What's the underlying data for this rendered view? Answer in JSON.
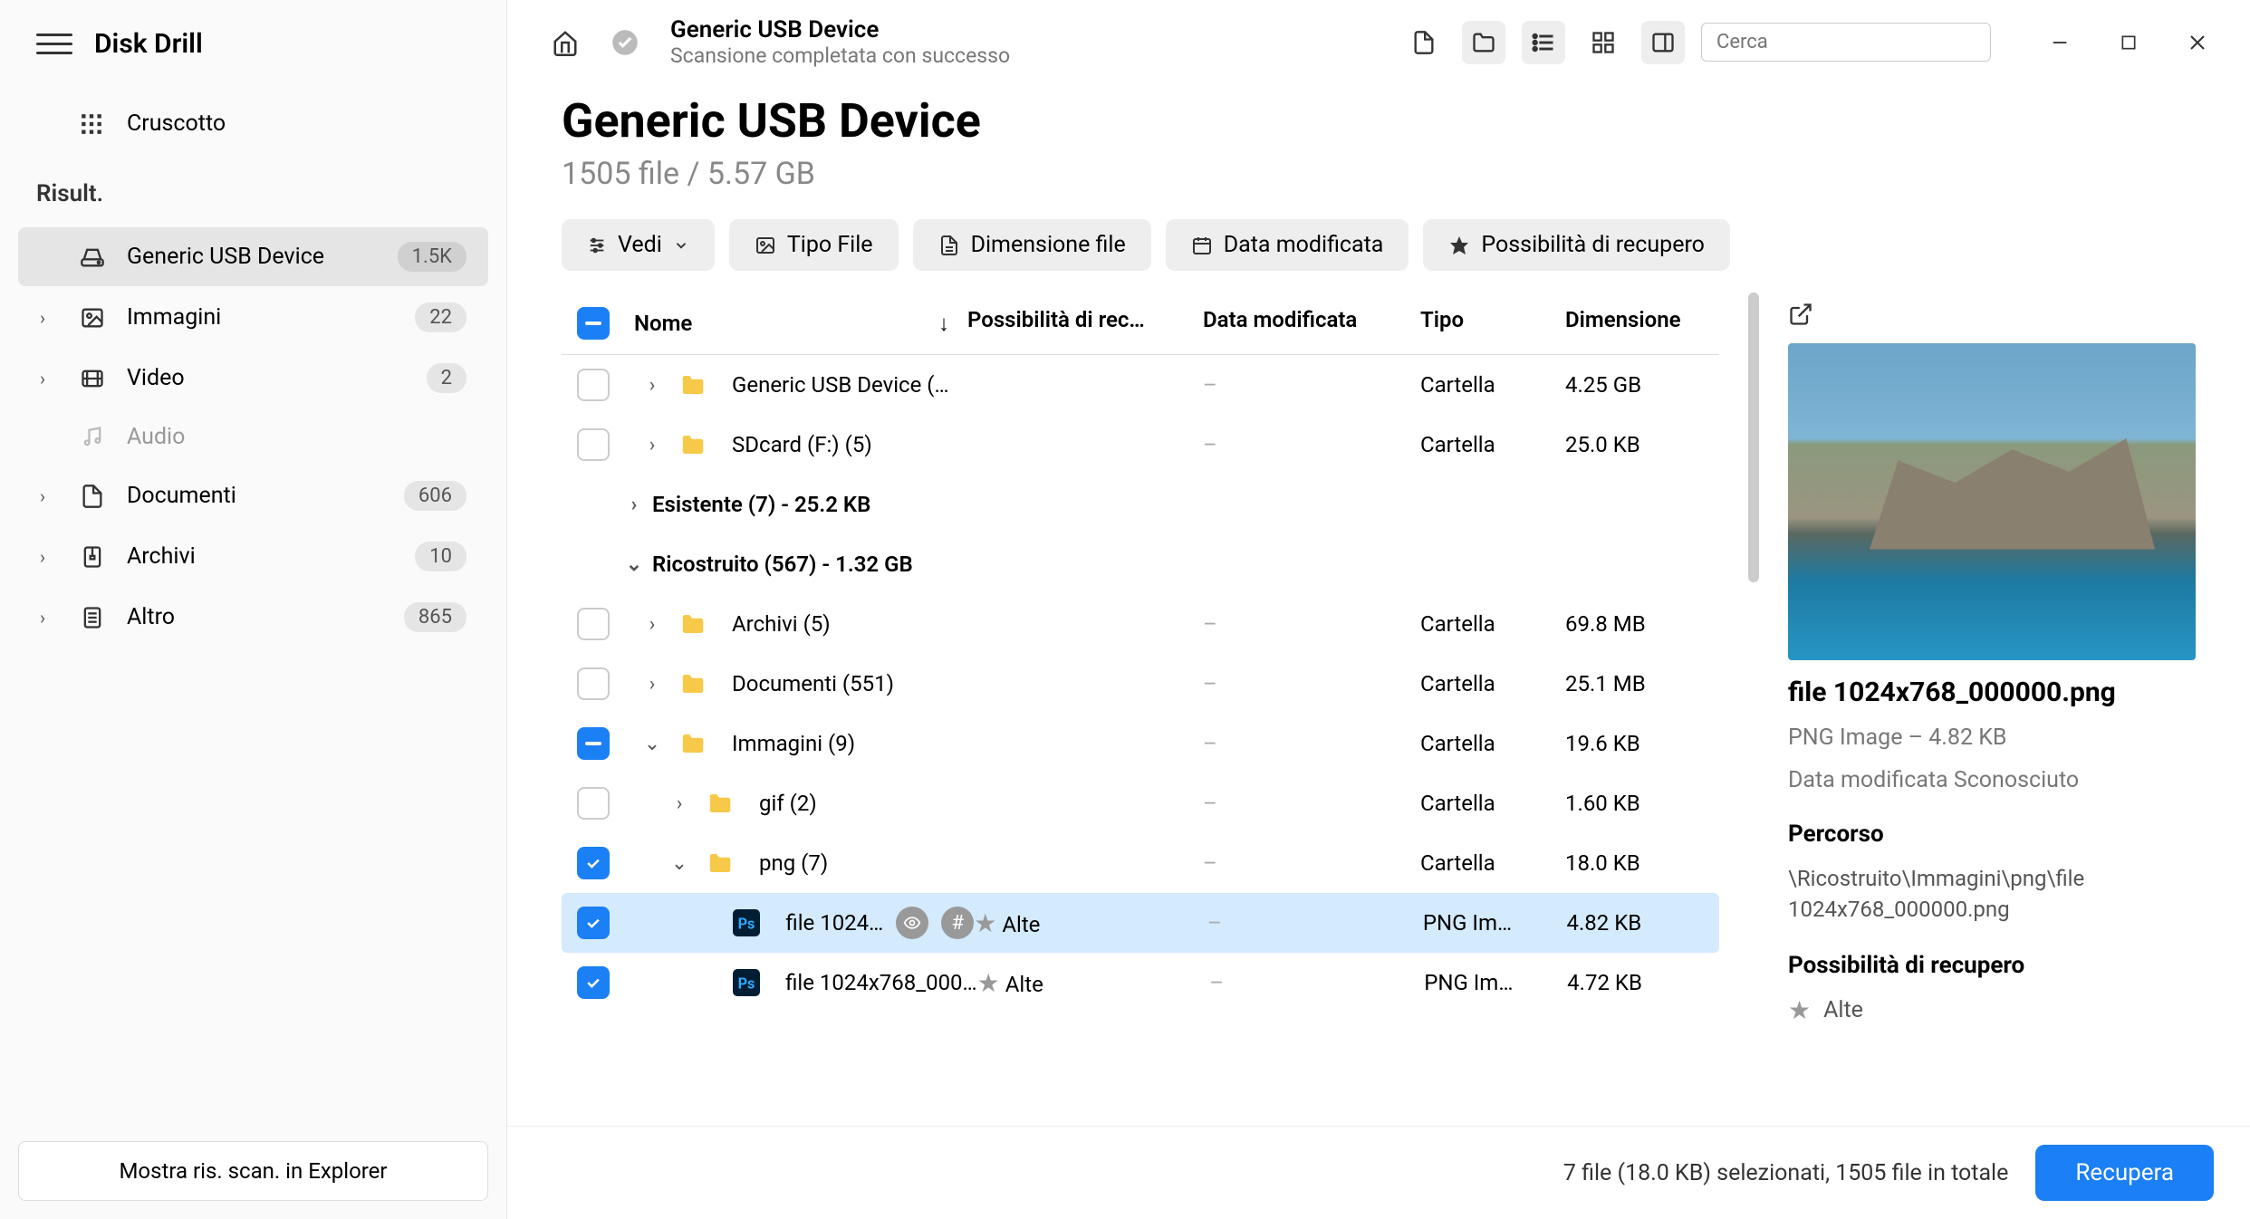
{
  "app": {
    "title": "Disk Drill"
  },
  "sidebar": {
    "dashboard": "Cruscotto",
    "results_label": "Risult.",
    "items": [
      {
        "label": "Generic USB Device",
        "badge": "1.5K",
        "icon": "drive",
        "active": true,
        "chevron": false
      },
      {
        "label": "Immagini",
        "badge": "22",
        "icon": "image",
        "chevron": true
      },
      {
        "label": "Video",
        "badge": "2",
        "icon": "video",
        "chevron": true
      },
      {
        "label": "Audio",
        "badge": "",
        "icon": "audio",
        "chevron": false,
        "dim": true
      },
      {
        "label": "Documenti",
        "badge": "606",
        "icon": "document",
        "chevron": true
      },
      {
        "label": "Archivi",
        "badge": "10",
        "icon": "archive",
        "chevron": true
      },
      {
        "label": "Altro",
        "badge": "865",
        "icon": "other",
        "chevron": true
      }
    ],
    "footer_btn": "Mostra ris. scan. in Explorer"
  },
  "toolbar": {
    "title": "Generic USB Device",
    "subtitle": "Scansione completata con successo",
    "search_placeholder": "Cerca"
  },
  "header": {
    "title": "Generic USB Device",
    "subtitle": "1505 file / 5.57 GB"
  },
  "filters": {
    "view": "Vedi",
    "type": "Tipo File",
    "size": "Dimensione file",
    "date": "Data modificata",
    "recov": "Possibilità di recupero"
  },
  "columns": {
    "name": "Nome",
    "recov": "Possibilità di rec…",
    "date": "Data modificata",
    "type": "Tipo",
    "size": "Dimensione"
  },
  "rows": [
    {
      "kind": "row",
      "check": "none",
      "indent": 0,
      "expander": "right",
      "icon": "folder",
      "name": "Generic USB Device (…",
      "recov": "",
      "date": "–",
      "type": "Cartella",
      "size": "4.25 GB"
    },
    {
      "kind": "row",
      "check": "none",
      "indent": 0,
      "expander": "right",
      "icon": "folder",
      "name": "SDcard (F:) (5)",
      "recov": "",
      "date": "–",
      "type": "Cartella",
      "size": "25.0 KB"
    },
    {
      "kind": "section",
      "expander": "right",
      "name": "Esistente (7) - 25.2 KB"
    },
    {
      "kind": "section",
      "expander": "down",
      "name": "Ricostruito (567) - 1.32 GB"
    },
    {
      "kind": "row",
      "check": "none",
      "indent": 0,
      "expander": "right",
      "icon": "folder",
      "name": "Archivi (5)",
      "recov": "",
      "date": "–",
      "type": "Cartella",
      "size": "69.8 MB"
    },
    {
      "kind": "row",
      "check": "none",
      "indent": 0,
      "expander": "right",
      "icon": "folder",
      "name": "Documenti (551)",
      "recov": "",
      "date": "–",
      "type": "Cartella",
      "size": "25.1 MB"
    },
    {
      "kind": "row",
      "check": "partial",
      "indent": 0,
      "expander": "down",
      "icon": "folder",
      "name": "Immagini (9)",
      "recov": "",
      "date": "–",
      "type": "Cartella",
      "size": "19.6 KB"
    },
    {
      "kind": "row",
      "check": "none",
      "indent": 1,
      "expander": "right",
      "icon": "folder",
      "name": "gif (2)",
      "recov": "",
      "date": "–",
      "type": "Cartella",
      "size": "1.60 KB"
    },
    {
      "kind": "row",
      "check": "checked",
      "indent": 1,
      "expander": "down",
      "icon": "folder",
      "name": "png (7)",
      "recov": "",
      "date": "–",
      "type": "Cartella",
      "size": "18.0 KB"
    },
    {
      "kind": "row",
      "check": "checked",
      "indent": 2,
      "expander": "",
      "icon": "ps",
      "name": "file 1024…",
      "pills": true,
      "recov": "Alte",
      "date": "–",
      "type": "PNG Im…",
      "size": "4.82 KB",
      "selected": true
    },
    {
      "kind": "row",
      "check": "checked",
      "indent": 2,
      "expander": "",
      "icon": "ps",
      "name": "file 1024x768_000…",
      "recov": "Alte",
      "date": "–",
      "type": "PNG Im…",
      "size": "4.72 KB"
    }
  ],
  "preview": {
    "filename": "file 1024x768_000000.png",
    "meta": "PNG Image – 4.82 KB",
    "modified": "Data modificata Sconosciuto",
    "path_label": "Percorso",
    "path": "\\Ricostruito\\Immagini\\png\\file 1024x768_000000.png",
    "recov_label": "Possibilità di recupero",
    "recov_value": "Alte"
  },
  "footer": {
    "status": "7 file (18.0 KB) selezionati, 1505 file in totale",
    "recover": "Recupera"
  }
}
